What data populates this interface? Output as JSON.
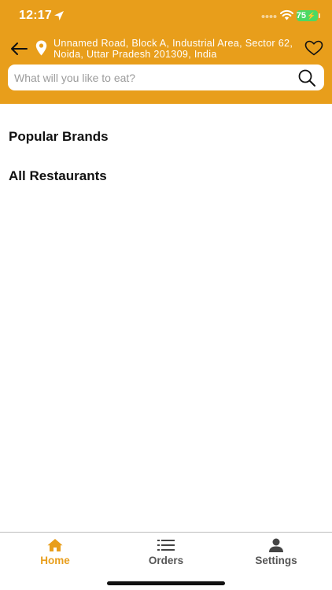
{
  "status_bar": {
    "time": "12:17",
    "battery": "75",
    "icons": [
      "location-arrow-icon",
      "signal-icon",
      "wifi-icon",
      "battery-charging-icon"
    ]
  },
  "header": {
    "address": "Unnamed Road, Block A, Industrial Area, Sector 62, Noida, Uttar Pradesh 201309, India",
    "back_icon": "arrow-left-icon",
    "location_icon": "map-pin-icon",
    "favorite_icon": "heart-outline-icon"
  },
  "search": {
    "value": "",
    "placeholder": "What will you like to eat?",
    "icon": "search-icon"
  },
  "sections": {
    "popular_brands": "Popular Brands",
    "all_restaurants": "All Restaurants"
  },
  "tabbar": {
    "tabs": [
      {
        "label": "Home",
        "icon": "home-icon",
        "active": true
      },
      {
        "label": "Orders",
        "icon": "list-icon",
        "active": false
      },
      {
        "label": "Settings",
        "icon": "person-icon",
        "active": false
      }
    ]
  },
  "colors": {
    "brand": "#E89E1B",
    "header_text": "#FFFFFF",
    "inactive_tab": "#555555",
    "battery": "#4CD964"
  }
}
